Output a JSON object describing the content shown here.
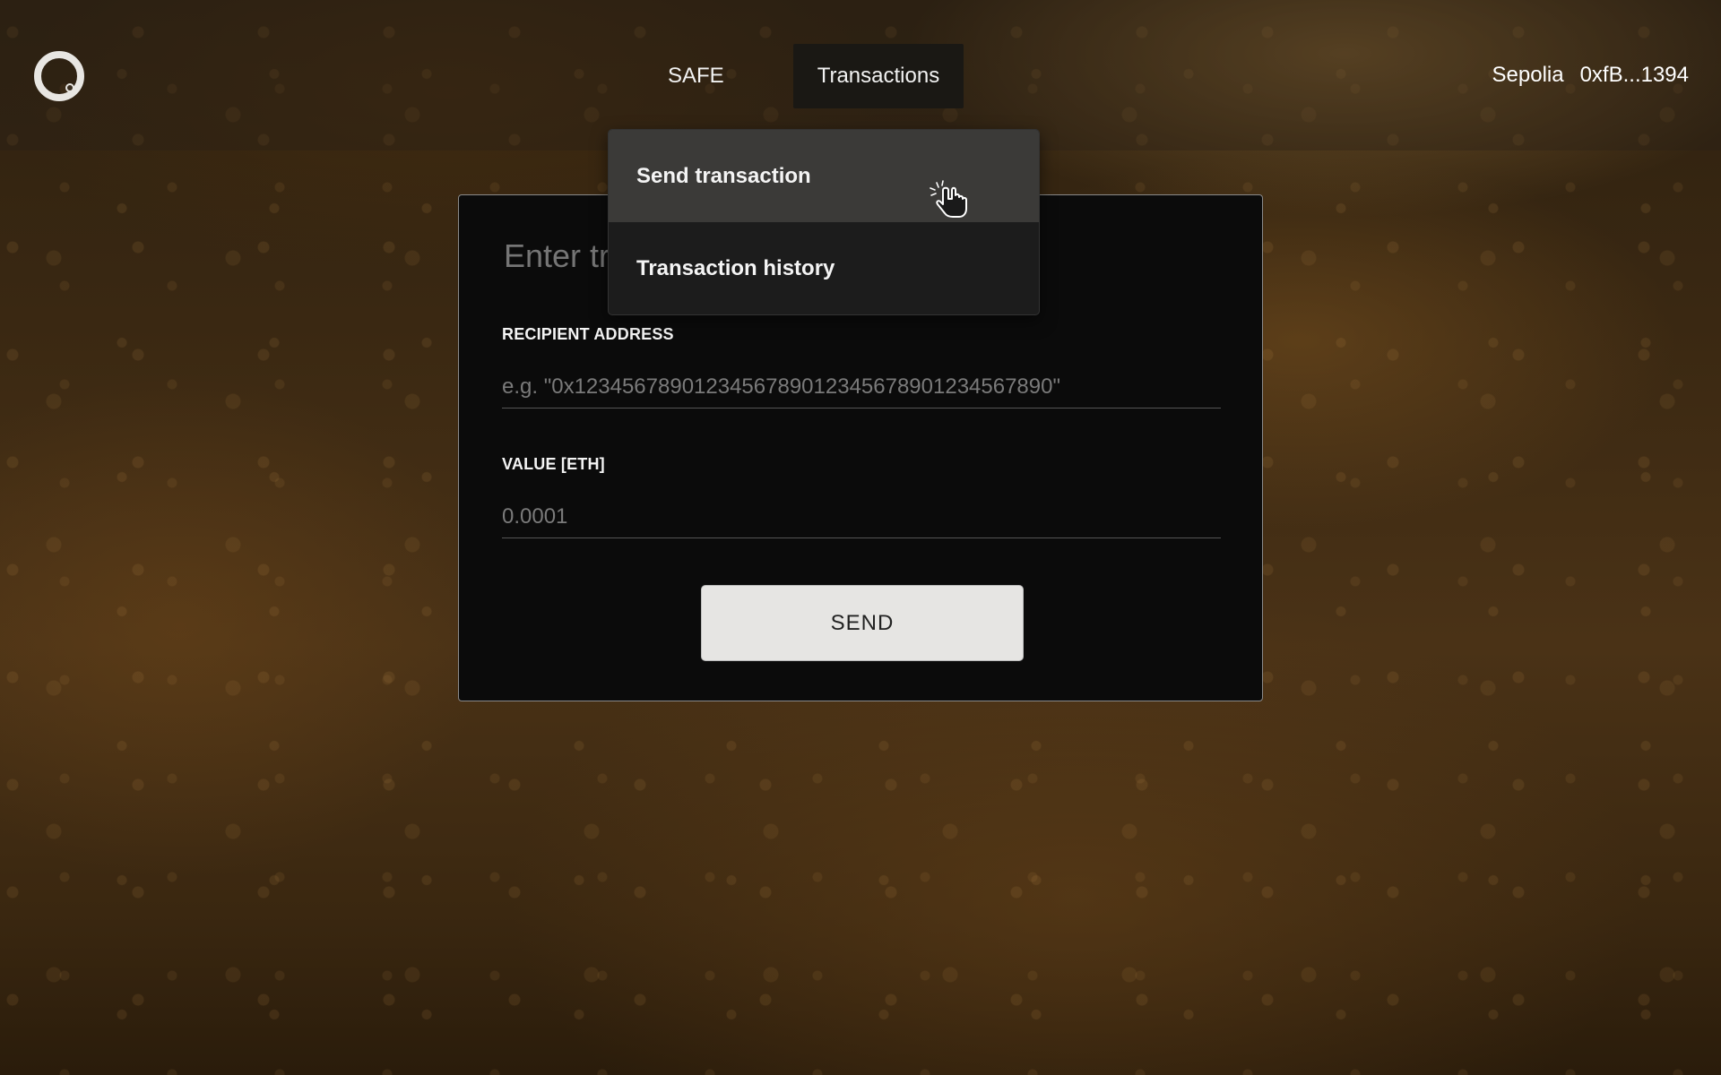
{
  "header": {
    "logo_icon": "ring-logo-icon",
    "nav": {
      "safe_label": "SAFE",
      "transactions_label": "Transactions"
    },
    "network": "Sepolia",
    "account": "0xfB...1394"
  },
  "dropdown": {
    "items": [
      {
        "label": "Send transaction"
      },
      {
        "label": "Transaction history"
      }
    ]
  },
  "form": {
    "title_placeholder": "Enter transaction title",
    "recipient_label": "RECIPIENT ADDRESS",
    "recipient_placeholder": "e.g. \"0x1234567890123456789012345678901234567890\"",
    "value_label": "VALUE [ETH]",
    "value_placeholder": "0.0001",
    "send_label": "SEND"
  },
  "cursor_icon": "pointer-hand-icon",
  "colors": {
    "card_bg": "#0b0b0b",
    "dropdown_bg": "#1c1c1c",
    "dropdown_hover": "#3b3a38",
    "button_bg": "#e6e5e3"
  }
}
